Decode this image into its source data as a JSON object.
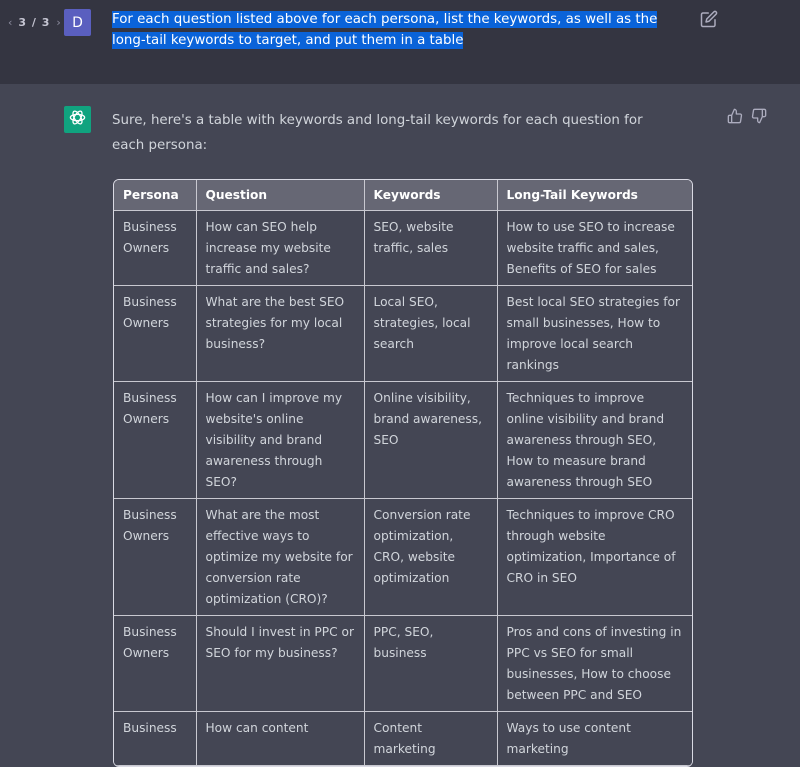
{
  "user_turn": {
    "pager": {
      "prev_icon": "chevron-left-icon",
      "count": "3 / 3",
      "next_icon": "chevron-right-icon"
    },
    "avatar_letter": "D",
    "message": "For each question listed above for each persona, list the keywords, as well as the long-tail keywords to target, and put them in a table",
    "edit_icon": "edit-icon"
  },
  "bot_turn": {
    "avatar_icon": "openai-logo-icon",
    "intro": "Sure, here's a table with keywords and long-tail keywords for each question for each persona:",
    "feedback": {
      "up_icon": "thumbs-up-icon",
      "down_icon": "thumbs-down-icon"
    },
    "table": {
      "headers": [
        "Persona",
        "Question",
        "Keywords",
        "Long-Tail Keywords"
      ],
      "rows": [
        [
          "Business Owners",
          "How can SEO help increase my website traffic and sales?",
          "SEO, website traffic, sales",
          "How to use SEO to increase website traffic and sales, Benefits of SEO for sales"
        ],
        [
          "Business Owners",
          "What are the best SEO strategies for my local business?",
          "Local SEO, strategies, local search",
          "Best local SEO strategies for small businesses, How to improve local search rankings"
        ],
        [
          "Business Owners",
          "How can I improve my website's online visibility and brand awareness through SEO?",
          "Online visibility, brand awareness, SEO",
          "Techniques to improve online visibility and brand awareness through SEO, How to measure brand awareness through SEO"
        ],
        [
          "Business Owners",
          "What are the most effective ways to optimize my website for conversion rate optimization (CRO)?",
          "Conversion rate optimization, CRO, website optimization",
          "Techniques to improve CRO through website optimization, Importance of CRO in SEO"
        ],
        [
          "Business Owners",
          "Should I invest in PPC or SEO for my business?",
          "PPC, SEO, business",
          "Pros and cons of investing in PPC vs SEO for small businesses, How to choose between PPC and SEO"
        ],
        [
          "Business",
          "How can content",
          "Content marketing",
          "Ways to use content marketing"
        ]
      ]
    }
  }
}
